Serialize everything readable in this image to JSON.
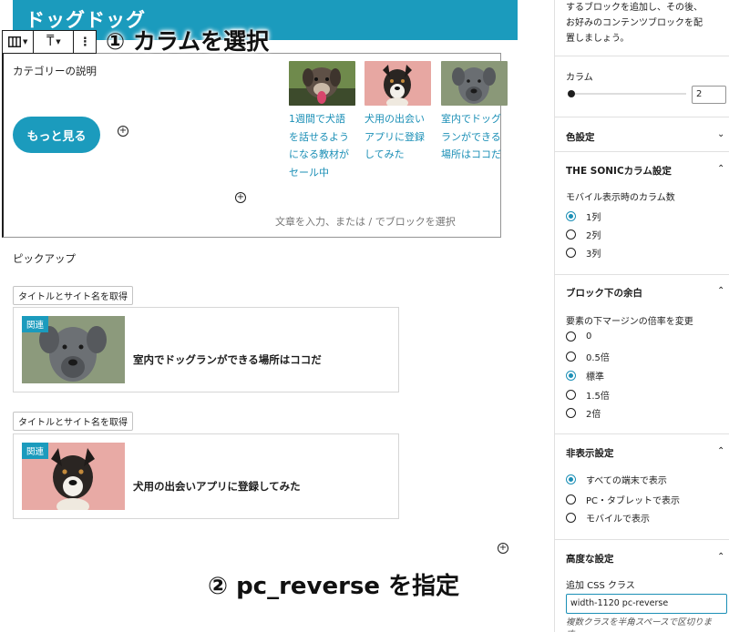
{
  "hero": {
    "title": "ドッグドッグ"
  },
  "toolbar": {
    "columns_icon": "columns-icon",
    "align_label": "T",
    "more_icon": "⋮"
  },
  "annotations": {
    "step1": "① カラムを選択",
    "step2": "② pc_reverse を指定"
  },
  "columns_block": {
    "category_desc": "カテゴリーの説明",
    "more_button": "もっと見る",
    "cards": [
      {
        "lines": [
          "1週間で犬語",
          "を話せるよう",
          "になる教材が",
          "セール中"
        ],
        "thumb": "dog-tongue"
      },
      {
        "lines": [
          "犬用の出会い",
          "アプリに登録",
          "してみた"
        ],
        "thumb": "dog-pink"
      },
      {
        "lines": [
          "室内でドッグ",
          "ランができる",
          "場所はココだ"
        ],
        "thumb": "dog-gray"
      }
    ],
    "placeholder": "文章を入力、または / でブロックを選択"
  },
  "pickup": {
    "heading": "ピックアップ",
    "cards": [
      {
        "fetch_label": "タイトルとサイト名を取得",
        "badge": "関連",
        "title": "室内でドッグランができる場所はココだ"
      },
      {
        "fetch_label": "タイトルとサイト名を取得",
        "badge": "関連",
        "title": "犬用の出会いアプリに登録してみた"
      }
    ]
  },
  "sidebar": {
    "intro_lines": [
      "するブロックを追加し、その後、",
      "お好みのコンテンツブロックを配",
      "置しましょう。"
    ],
    "columns_label": "カラム",
    "columns_value": "2",
    "columns_fraction": 0.0,
    "color_settings": "色設定",
    "sonic_columns": {
      "title": "THE SONICカラム設定",
      "subtitle": "モバイル表示時のカラム数",
      "options": [
        "1列",
        "2列",
        "3列"
      ],
      "selected": 0
    },
    "margin": {
      "title": "ブロック下の余白",
      "subtitle": "要素の下マージンの倍率を変更",
      "options": [
        "0",
        "0.5倍",
        "標準",
        "1.5倍",
        "2倍"
      ],
      "selected": 2
    },
    "hide": {
      "title": "非表示設定",
      "options": [
        "すべての端末で表示",
        "PC・タブレットで表示",
        "モバイルで表示"
      ],
      "selected": 0
    },
    "advanced": {
      "title": "高度な設定",
      "css_label": "追加 CSS クラス",
      "css_value": "width-1120 pc-reverse",
      "help": "複数クラスを半角スペースで区切りま す。"
    },
    "accent_color": "#1b8fb6",
    "brand_color": "#1b9bbd"
  }
}
